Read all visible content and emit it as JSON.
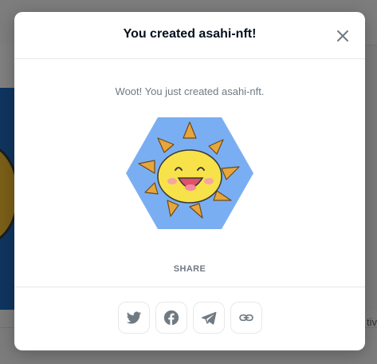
{
  "background": {
    "right_partial_text": "tiv"
  },
  "modal": {
    "title": "You created asahi-nft!",
    "close_icon": "close-icon",
    "message": "Woot! You just created asahi-nft.",
    "nft_image": "sun-character-hexagon",
    "share_label": "SHARE",
    "share_buttons": [
      {
        "icon": "twitter-icon"
      },
      {
        "icon": "facebook-icon"
      },
      {
        "icon": "telegram-icon"
      },
      {
        "icon": "link-icon"
      }
    ]
  },
  "colors": {
    "title": "#04111d",
    "muted": "#707a83",
    "hexagon": "#7aaef2",
    "sun": "#f7e24a",
    "rays": "#e8a63a"
  }
}
